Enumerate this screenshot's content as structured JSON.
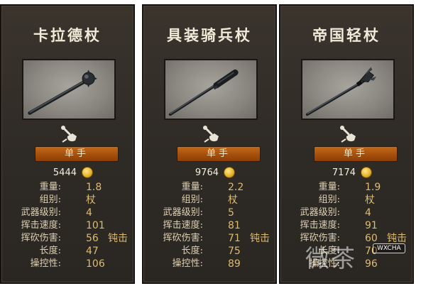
{
  "cards": [
    {
      "title": "卡拉德杖",
      "hand": "单手",
      "price": "5444",
      "stats": {
        "weight": {
          "label": "重量:",
          "value": "1.8"
        },
        "group": {
          "label": "组别:",
          "value": "杖"
        },
        "tier": {
          "label": "武器级别:",
          "value": "4"
        },
        "swing_speed": {
          "label": "挥击速度:",
          "value": "101"
        },
        "swing_damage": {
          "label": "挥砍伤害:",
          "value": "56",
          "extra": "钝击"
        },
        "length": {
          "label": "长度:",
          "value": "47"
        },
        "handling": {
          "label": "操控性:",
          "value": "106"
        }
      }
    },
    {
      "title": "具装骑兵杖",
      "hand": "单手",
      "price": "9764",
      "stats": {
        "weight": {
          "label": "重量:",
          "value": "2.2"
        },
        "group": {
          "label": "组别:",
          "value": "杖"
        },
        "tier": {
          "label": "武器级别:",
          "value": "5"
        },
        "swing_speed": {
          "label": "挥击速度:",
          "value": "81"
        },
        "swing_damage": {
          "label": "挥砍伤害:",
          "value": "71",
          "extra": "钝击"
        },
        "length": {
          "label": "长度:",
          "value": "75"
        },
        "handling": {
          "label": "操控性:",
          "value": "89"
        }
      }
    },
    {
      "title": "帝国轻杖",
      "hand": "单手",
      "price": "7174",
      "stats": {
        "weight": {
          "label": "重量:",
          "value": "1.9"
        },
        "group": {
          "label": "组别:",
          "value": "杖"
        },
        "tier": {
          "label": "武器级别:",
          "value": "4"
        },
        "swing_speed": {
          "label": "挥击速度:",
          "value": "91"
        },
        "swing_damage": {
          "label": "挥砍伤害:",
          "value": "60",
          "extra": "钝击"
        },
        "length": {
          "label": "长度:",
          "value": "70"
        },
        "handling": {
          "label": "操控性:",
          "value": "96"
        }
      }
    }
  ],
  "icons": {
    "weapon": "mace-icon",
    "type": "one-handed-mace-type-icon",
    "currency": "gold-coin-icon"
  },
  "watermark": {
    "text": "微茶",
    "badge": "WXCHA"
  },
  "colors": {
    "badge": "#b85a12",
    "value": "#dcbc72",
    "title": "#f0ead8",
    "panel": "#2f2a25"
  }
}
